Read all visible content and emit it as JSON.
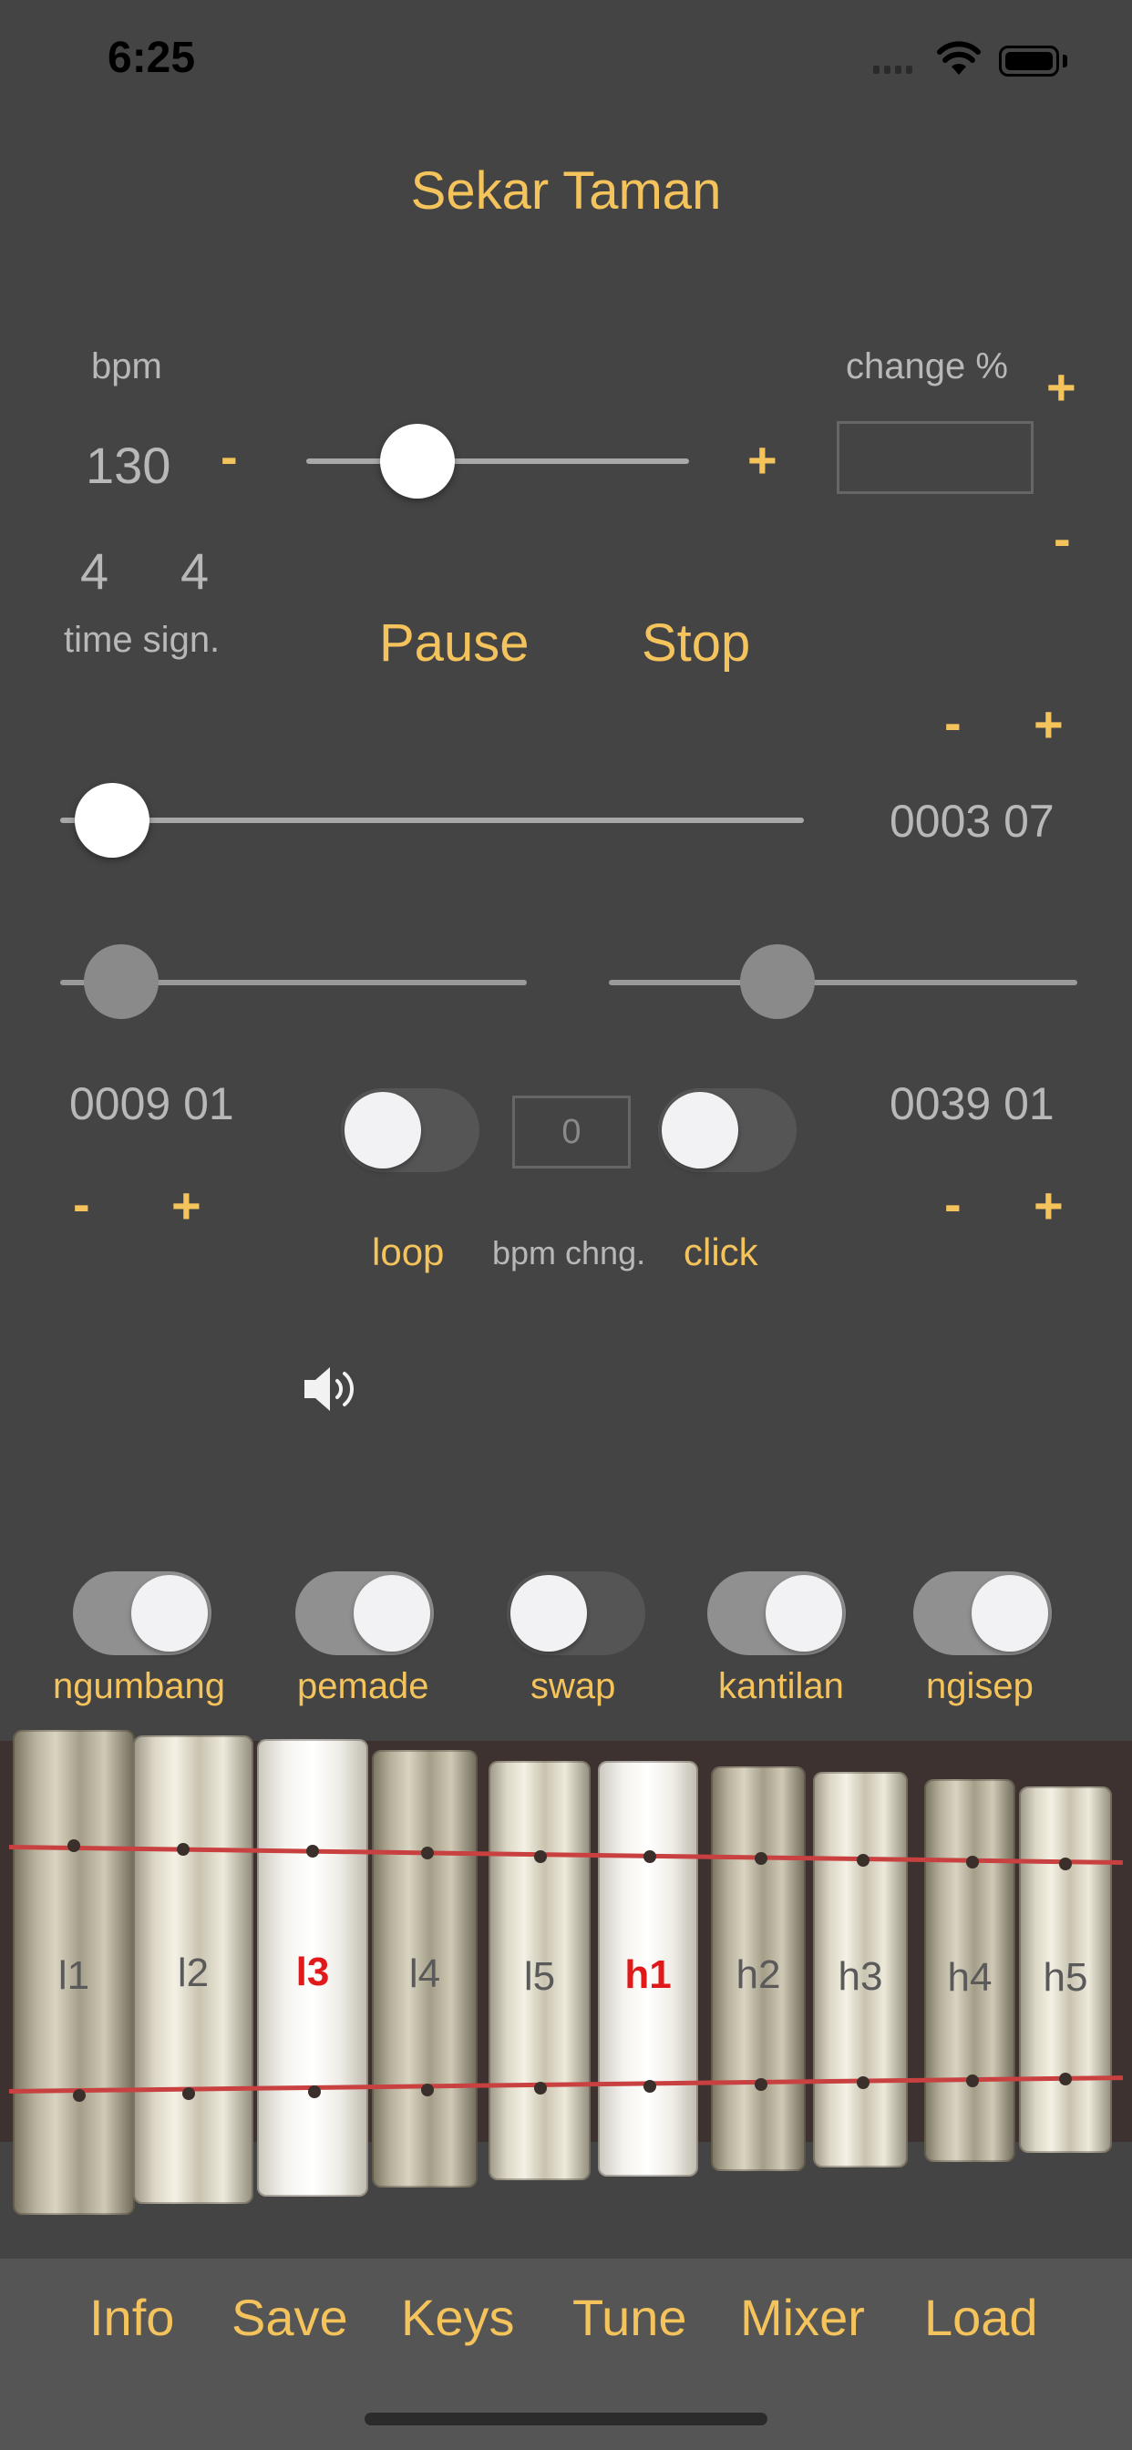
{
  "status": {
    "time": "6:25"
  },
  "title": "Sekar Taman",
  "tempo": {
    "bpm_label": "bpm",
    "bpm_value": "130",
    "minus": "-",
    "plus": "+",
    "slider_fraction": 0.29,
    "change_label": "change %",
    "change_plus": "+",
    "change_minus": "-",
    "change_value": ""
  },
  "time_signature": {
    "top": "4",
    "bottom": "4",
    "label": "time sign."
  },
  "transport": {
    "pause": "Pause",
    "stop": "Stop",
    "minus": "-",
    "plus": "+"
  },
  "position": {
    "value": "0003 07",
    "slider_fraction": 0.07
  },
  "loop_start": {
    "value": "0009 01",
    "minus": "-",
    "plus": "+",
    "slider_fraction": 0.13
  },
  "loop_end": {
    "value": "0039 01",
    "minus": "-",
    "plus": "+",
    "slider_fraction": 0.36
  },
  "controls": {
    "loop_label": "loop",
    "bpm_change_label": "bpm chng.",
    "bpm_change_value": "0",
    "click_label": "click"
  },
  "icons": {
    "speaker": "speaker-icon"
  },
  "instrument_toggles": [
    {
      "label": "ngumbang",
      "on": true
    },
    {
      "label": "pemade",
      "on": true
    },
    {
      "label": "swap",
      "on": false
    },
    {
      "label": "kantilan",
      "on": true
    },
    {
      "label": "ngisep",
      "on": true
    }
  ],
  "bars": [
    "l1",
    "l2",
    "l3",
    "l4",
    "l5",
    "h1",
    "h2",
    "h3",
    "h4",
    "h5"
  ],
  "active_bars": [
    "l3",
    "h1"
  ],
  "bottom_tabs": [
    "Info",
    "Save",
    "Keys",
    "Tune",
    "Mixer",
    "Load"
  ],
  "colors": {
    "accent": "#F5C35B",
    "background": "#444444",
    "active_note": "#E01A1A"
  }
}
